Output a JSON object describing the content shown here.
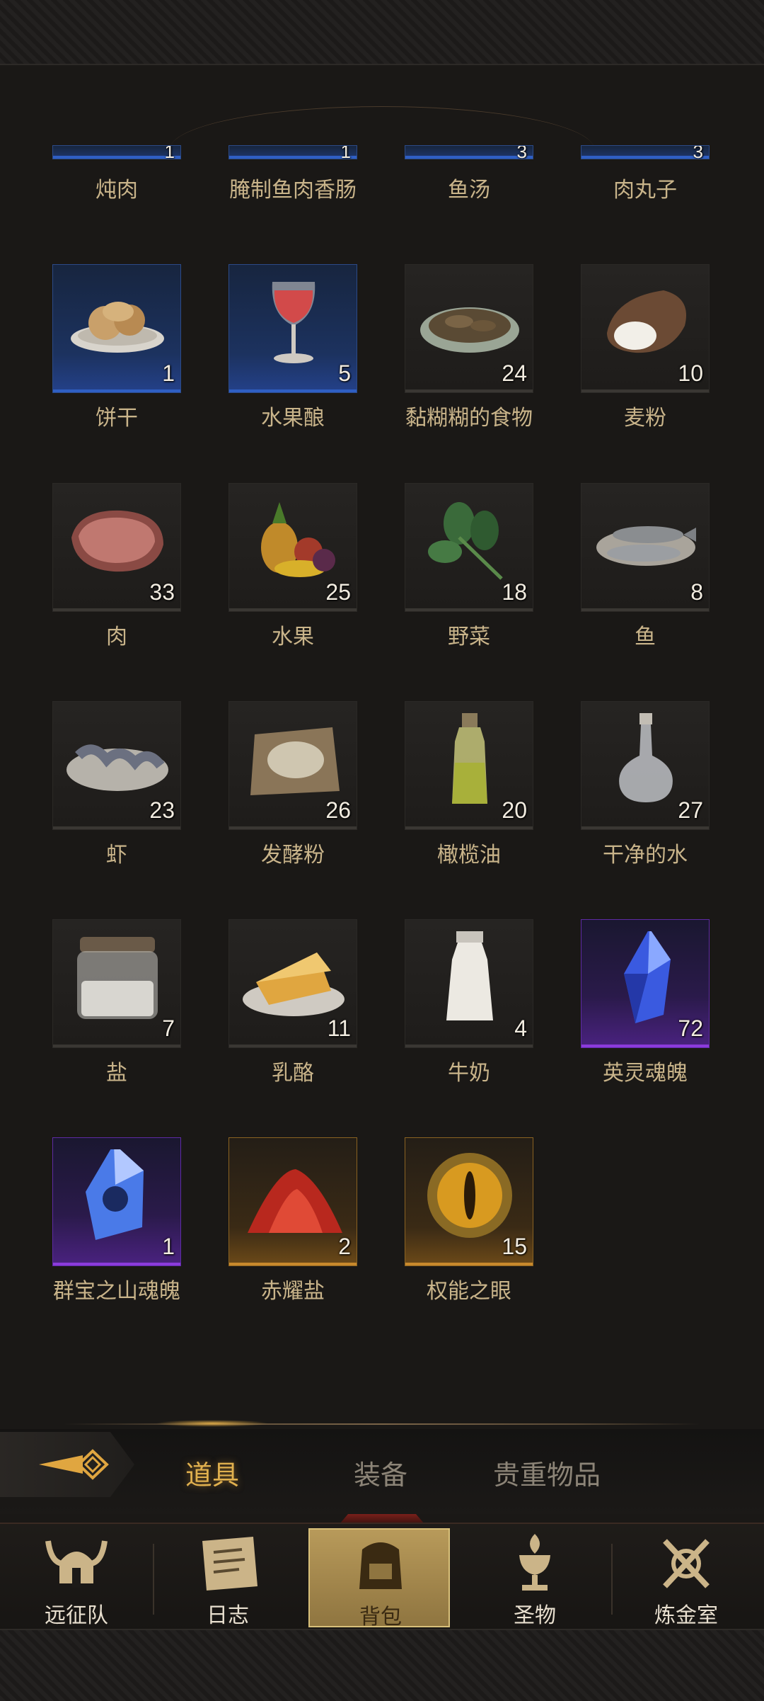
{
  "partial_row": [
    {
      "name": "炖肉",
      "count": "1",
      "rarity": "blue"
    },
    {
      "name": "腌制鱼肉香肠",
      "count": "1",
      "rarity": "blue"
    },
    {
      "name": "鱼汤",
      "count": "3",
      "rarity": "blue"
    },
    {
      "name": "肉丸子",
      "count": "3",
      "rarity": "blue"
    }
  ],
  "items": [
    {
      "name": "饼干",
      "count": "1",
      "rarity": "blue",
      "icon": "biscuit-icon"
    },
    {
      "name": "水果酿",
      "count": "5",
      "rarity": "blue",
      "icon": "wine-glass-icon"
    },
    {
      "name": "黏糊糊的食物",
      "count": "24",
      "rarity": "common",
      "icon": "mush-plate-icon"
    },
    {
      "name": "麦粉",
      "count": "10",
      "rarity": "common",
      "icon": "flour-sack-icon"
    },
    {
      "name": "肉",
      "count": "33",
      "rarity": "common",
      "icon": "meat-icon"
    },
    {
      "name": "水果",
      "count": "25",
      "rarity": "common",
      "icon": "fruit-icon"
    },
    {
      "name": "野菜",
      "count": "18",
      "rarity": "common",
      "icon": "greens-icon"
    },
    {
      "name": "鱼",
      "count": "8",
      "rarity": "common",
      "icon": "fish-icon"
    },
    {
      "name": "虾",
      "count": "23",
      "rarity": "common",
      "icon": "shrimp-icon"
    },
    {
      "name": "发酵粉",
      "count": "26",
      "rarity": "common",
      "icon": "yeast-icon"
    },
    {
      "name": "橄榄油",
      "count": "20",
      "rarity": "common",
      "icon": "oil-bottle-icon"
    },
    {
      "name": "干净的水",
      "count": "27",
      "rarity": "common",
      "icon": "water-bottle-icon"
    },
    {
      "name": "盐",
      "count": "7",
      "rarity": "common",
      "icon": "salt-jar-icon"
    },
    {
      "name": "乳酪",
      "count": "11",
      "rarity": "common",
      "icon": "cheese-icon"
    },
    {
      "name": "牛奶",
      "count": "4",
      "rarity": "common",
      "icon": "milk-bottle-icon"
    },
    {
      "name": "英灵魂魄",
      "count": "72",
      "rarity": "purple",
      "icon": "blue-crystal-icon"
    },
    {
      "name": "群宝之山魂魄",
      "count": "1",
      "rarity": "purple",
      "icon": "spirit-crystal-icon"
    },
    {
      "name": "赤耀盐",
      "count": "2",
      "rarity": "gold",
      "icon": "red-salt-icon"
    },
    {
      "name": "权能之眼",
      "count": "15",
      "rarity": "gold",
      "icon": "golden-eye-icon"
    }
  ],
  "tabs": {
    "items_label": "道具",
    "equipment_label": "装备",
    "valuables_label": "贵重物品",
    "active": "道具"
  },
  "nav": {
    "expedition": "远征队",
    "journal": "日志",
    "backpack": "背包",
    "relics": "圣物",
    "alchemy": "炼金室",
    "active": "背包"
  },
  "colors": {
    "accent": "#e0b04e",
    "blue_rarity": "#2f5fc4",
    "purple_rarity": "#8c3bdc",
    "gold_rarity": "#c8892c",
    "text": "#c9b48a"
  }
}
